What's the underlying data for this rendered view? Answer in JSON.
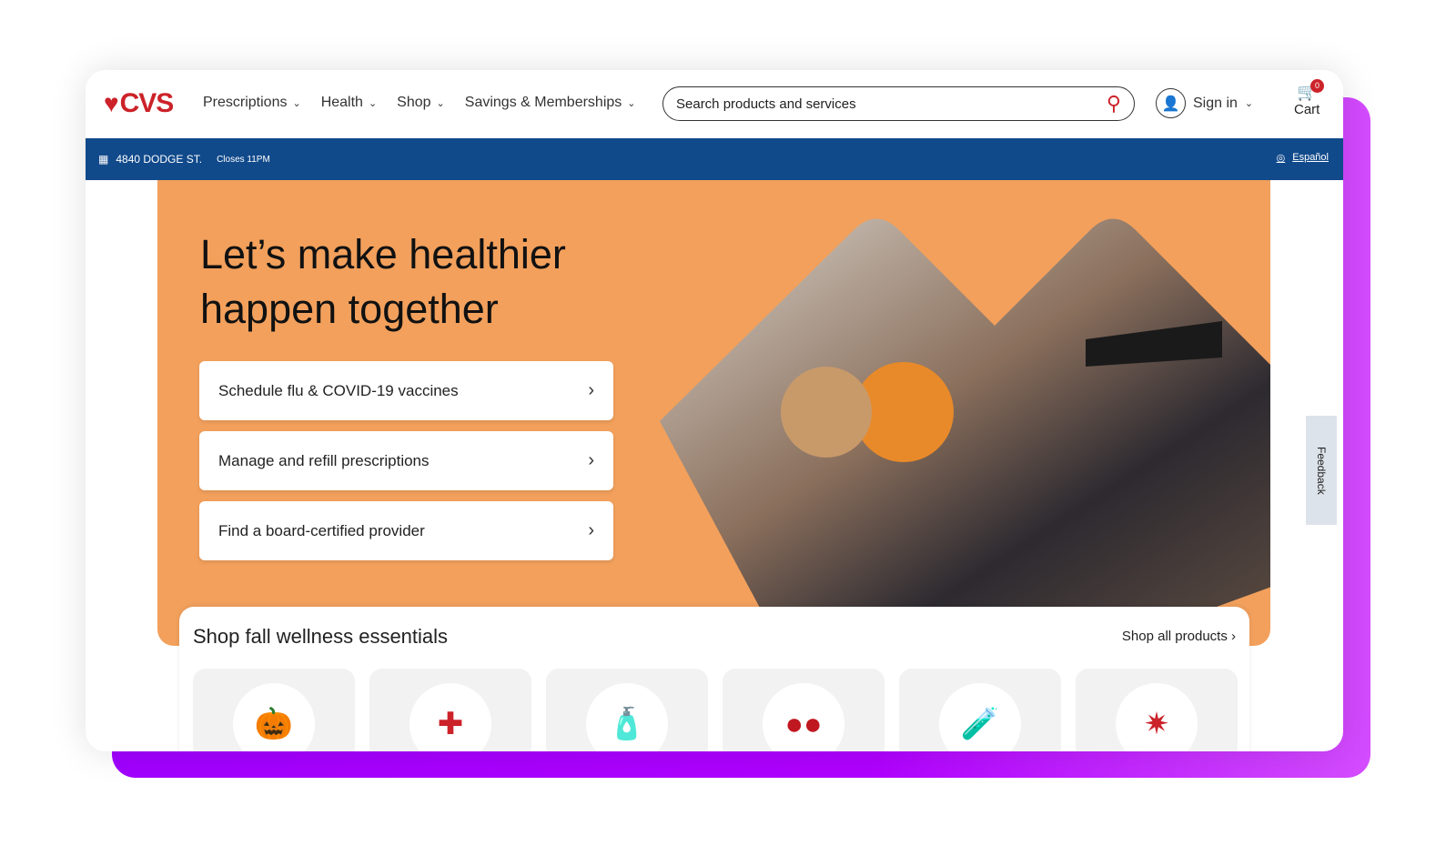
{
  "header": {
    "logo": "CVS",
    "nav": [
      "Prescriptions",
      "Health",
      "Shop",
      "Savings & Memberships"
    ],
    "search_placeholder": "Search products and services",
    "signin": "Sign in",
    "cart_label": "Cart",
    "cart_count": "0"
  },
  "store_bar": {
    "address": "4840 DODGE ST.",
    "hours": "Closes 11PM",
    "language": "Español"
  },
  "hero": {
    "title": "Let’s make healthier happen together",
    "ctas": [
      "Schedule flu & COVID-19 vaccines",
      "Manage and refill prescriptions",
      "Find a board-certified provider"
    ]
  },
  "feedback": "Feedback",
  "shop": {
    "title": "Shop fall wellness essentials",
    "link": "Shop all products",
    "products": [
      "pumpkin-bucket-icon",
      "first-aid-kit-icon",
      "vitamin-bottle-icon",
      "cough-drops-icon",
      "cold-medicine-icon",
      "test-kit-icon"
    ]
  },
  "colors": {
    "brand": "#cc2229",
    "bar": "#114a8b",
    "hero": "#f2a05c",
    "accent": "#a100ff"
  }
}
